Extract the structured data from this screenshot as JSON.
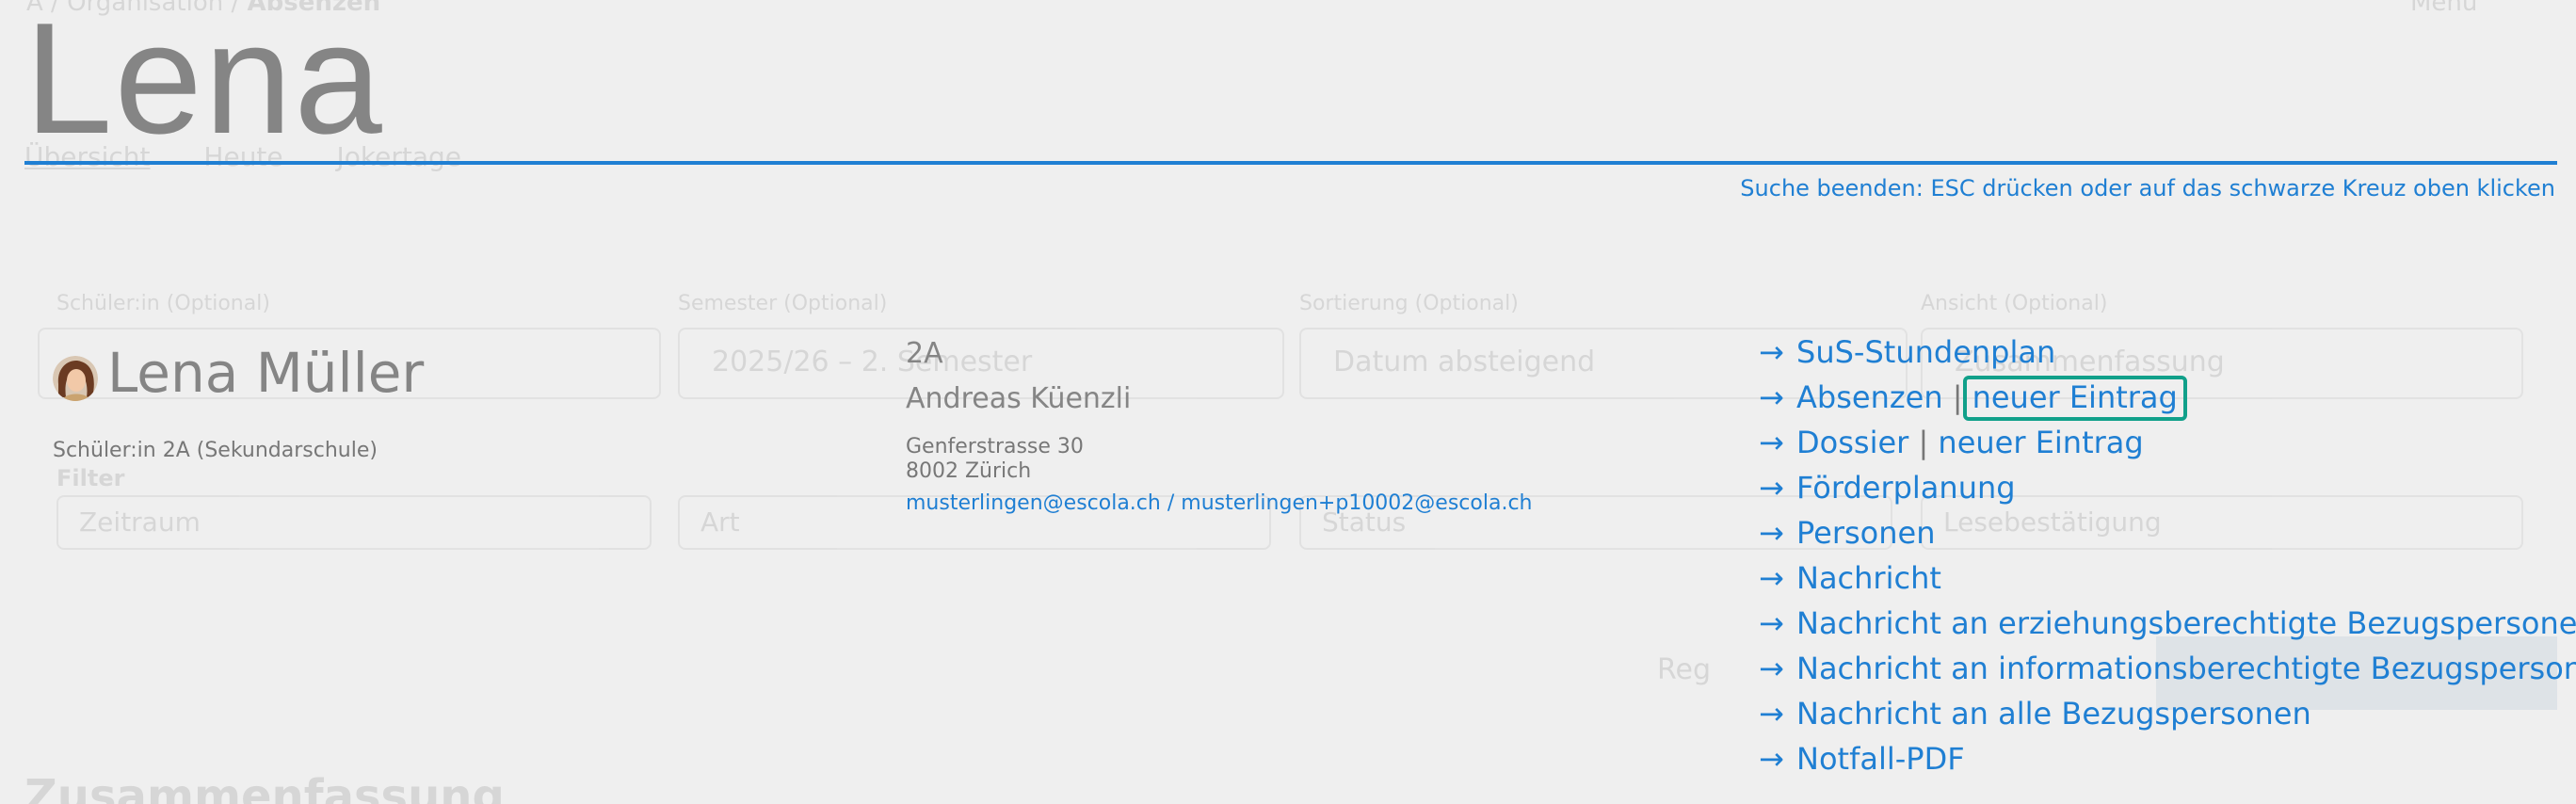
{
  "background": {
    "breadcrumb": [
      "A",
      "Organisation",
      "Absenzen"
    ],
    "tabs": [
      "Übersicht",
      "Heute",
      "Jokertage"
    ],
    "fields": [
      {
        "label": "Schüler:in",
        "hint": "(Optional)",
        "value": ""
      },
      {
        "label": "Semester",
        "hint": "(Optional)",
        "value": "2025/26 – 2. Semester"
      },
      {
        "label": "Sortierung",
        "hint": "(Optional)",
        "value": "Datum absteigend"
      },
      {
        "label": "Ansicht",
        "hint": "(Optional)",
        "value": "Zusammenfassung"
      }
    ],
    "filter_label": "Filter",
    "filters": [
      "Zeitraum",
      "Art",
      "Status",
      "Lesebestätigung"
    ],
    "register_button": "Reg",
    "section_title": "Zusammenfassung",
    "menu": "Menu"
  },
  "search": {
    "query": "Lena",
    "exit_hint": "Suche beenden: ESC drücken oder auf das schwarze Kreuz oben klicken"
  },
  "result": {
    "name": "Lena Müller",
    "role": "Schüler:in 2A (Sekundarschule)",
    "class": "2A",
    "teacher": "Andreas Küenzli",
    "street": "Genferstrasse 30",
    "city": "8002 Zürich",
    "email1": "musterlingen@escola.ch",
    "email_separator": "/",
    "email2": "musterlingen+p10002@escola.ch"
  },
  "links": {
    "arrow": "→",
    "separator": "|",
    "stundenplan": "SuS-Stundenplan",
    "absenzen": "Absenzen",
    "absenzen_new": "neuer Eintrag",
    "dossier": "Dossier",
    "dossier_new": "neuer Eintrag",
    "foerderplanung": "Förderplanung",
    "personen": "Personen",
    "nachricht": "Nachricht",
    "nachricht_erz": "Nachricht an erziehungsberechtigte Bezugspersonen",
    "nachricht_info": "Nachricht an informationsberechtigte Bezugspersonen",
    "nachricht_alle": "Nachricht an alle Bezugspersonen",
    "notfall": "Notfall-PDF"
  },
  "colors": {
    "accent": "#1f7fd3",
    "focus": "#11a08a",
    "muted": "#858585",
    "background": "#efefef"
  }
}
